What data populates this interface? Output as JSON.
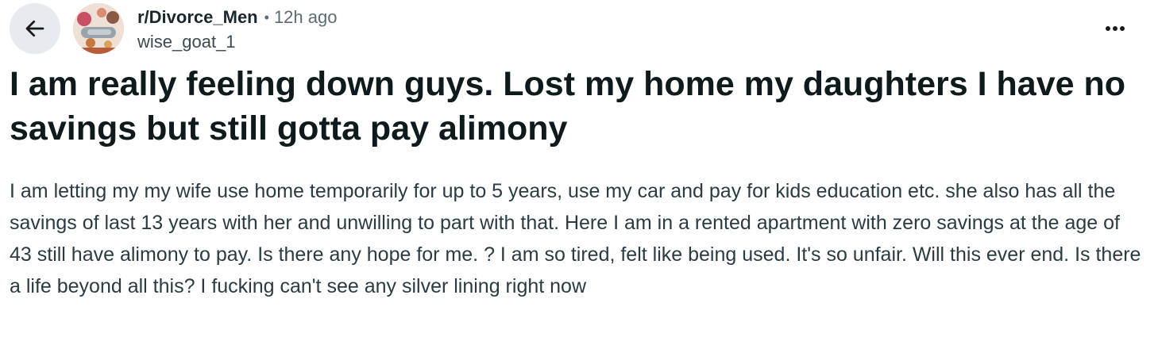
{
  "post": {
    "subreddit": "r/Divorce_Men",
    "separator": "•",
    "time_ago": "12h ago",
    "author": "wise_goat_1",
    "title": "I am really feeling down guys. Lost my home my daughters I have no savings but still gotta pay alimony",
    "body": "I am letting my my wife use home temporarily for up to 5 years, use my car and pay for kids education etc. she also has all the savings of last 13 years with her and unwilling to part with that. Here I am in a rented apartment with zero savings at the age of 43 still have alimony to pay. Is there any hope for me. ? I am so tired, felt like being used. It's so unfair. Will this ever end. Is there a life beyond all this? I fucking can't see any silver lining right now"
  },
  "icons": {
    "back": "arrow-left-icon",
    "avatar": "subreddit-avatar",
    "more": "more-horizontal-icon"
  },
  "colors": {
    "text_primary": "#0f1a1c",
    "text_body": "#2a3c42",
    "text_secondary": "#5c6c74",
    "back_button_bg": "#e5ebee"
  }
}
